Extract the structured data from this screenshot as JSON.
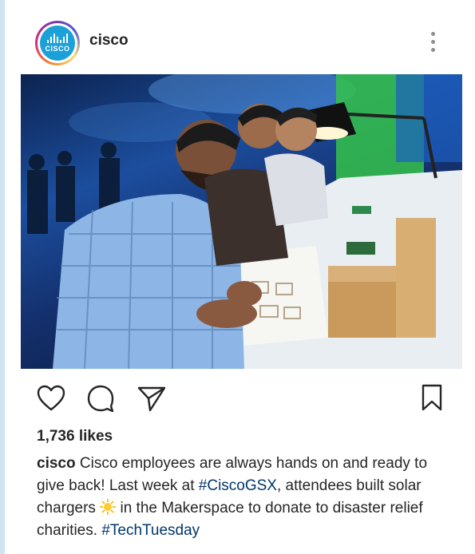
{
  "post": {
    "username": "cisco",
    "avatar_text": "CISCO",
    "menu_icon": "more-vertical-icon",
    "likes": "1,736 likes",
    "caption": {
      "username": "cisco",
      "text_1": " Cisco employees are always hands on and ready to give back! Last week at ",
      "hashtag_1": "#CiscoGSX",
      "text_2": ", attendees built solar chargers ",
      "emoji": "sun-emoji",
      "text_3": " in the Makerspace to donate to disaster relief charities. ",
      "hashtag_2": "#TechTuesday"
    },
    "actions": [
      "heart-icon",
      "comment-icon",
      "share-icon",
      "bookmark-icon"
    ],
    "colors": {
      "text": "#262626",
      "hashtag": "#00376b",
      "avatar_bg": "#1ba0d7",
      "icon_gray": "#8e8e8e"
    }
  }
}
